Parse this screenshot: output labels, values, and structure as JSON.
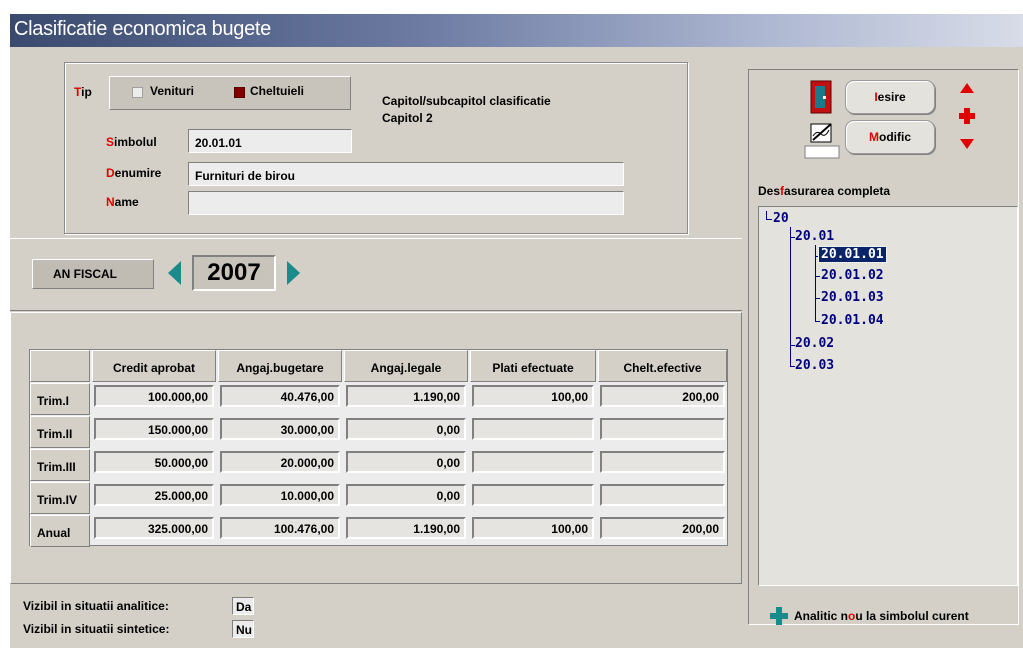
{
  "window": {
    "title": "Clasificatie economica bugete"
  },
  "form": {
    "tip_label": {
      "first": "T",
      "rest": "ip"
    },
    "tip_options": [
      {
        "label": "Venituri",
        "checked": false
      },
      {
        "label": "Cheltuieli",
        "checked": true
      }
    ],
    "simbol_label": {
      "first": "S",
      "rest": "imbolul"
    },
    "simbol_value": "20.01.01",
    "denumire_label": {
      "first": "D",
      "rest": "enumire"
    },
    "denumire_value": "Furnituri de birou",
    "name_label": {
      "first": "N",
      "rest": "ame"
    },
    "name_value": "",
    "capitol_title": "Capitol/subcapitol clasificatie",
    "capitol_value": "Capitol 2"
  },
  "fiscal": {
    "label": "AN FISCAL",
    "year": "2007"
  },
  "table": {
    "columns": [
      "Credit aprobat",
      "Angaj.bugetare",
      "Angaj.legale",
      "Plati efectuate",
      "Chelt.efective"
    ],
    "rows": [
      {
        "label": "Trim.I",
        "values": [
          "100.000,00",
          "40.476,00",
          "1.190,00",
          "100,00",
          "200,00"
        ]
      },
      {
        "label": "Trim.II",
        "values": [
          "150.000,00",
          "30.000,00",
          "0,00",
          "",
          ""
        ]
      },
      {
        "label": "Trim.III",
        "values": [
          "50.000,00",
          "20.000,00",
          "0,00",
          "",
          ""
        ]
      },
      {
        "label": "Trim.IV",
        "values": [
          "25.000,00",
          "10.000,00",
          "0,00",
          "",
          ""
        ]
      },
      {
        "label": "Anual",
        "values": [
          "325.000,00",
          "100.476,00",
          "1.190,00",
          "100,00",
          "200,00"
        ]
      }
    ]
  },
  "footer": {
    "analitice_label": "Vizibil in situatii analitice:",
    "analitice_value": "Da",
    "sintetice_label": "Vizibil in situatii sintetice:",
    "sintetice_value": "Nu"
  },
  "sidebar": {
    "iesire": {
      "first": "I",
      "rest": "esire"
    },
    "modific": {
      "first": "M",
      "rest": "odific"
    },
    "tree_title": {
      "pre": "Des",
      "accent": "f",
      "post": "asurarea completa"
    },
    "tree": [
      "20",
      "20.01",
      "20.01.01",
      "20.01.02",
      "20.01.03",
      "20.01.04",
      "20.02",
      "20.03"
    ],
    "selected": "20.01.01",
    "analitic_label": {
      "pre": "Analitic n",
      "accent": "o",
      "post": "u la simbolul curent"
    }
  },
  "colors": {
    "accent_red": "#e00000",
    "tree_blue": "#000080",
    "arrow_teal": "#1a8a8a",
    "selection": "#0a246a"
  },
  "icons": [
    "door-exit-icon",
    "edit-pen-icon",
    "arrow-up-icon",
    "plus-icon",
    "arrow-down-icon",
    "prev-arrow-icon",
    "next-arrow-icon",
    "add-analytic-icon"
  ]
}
